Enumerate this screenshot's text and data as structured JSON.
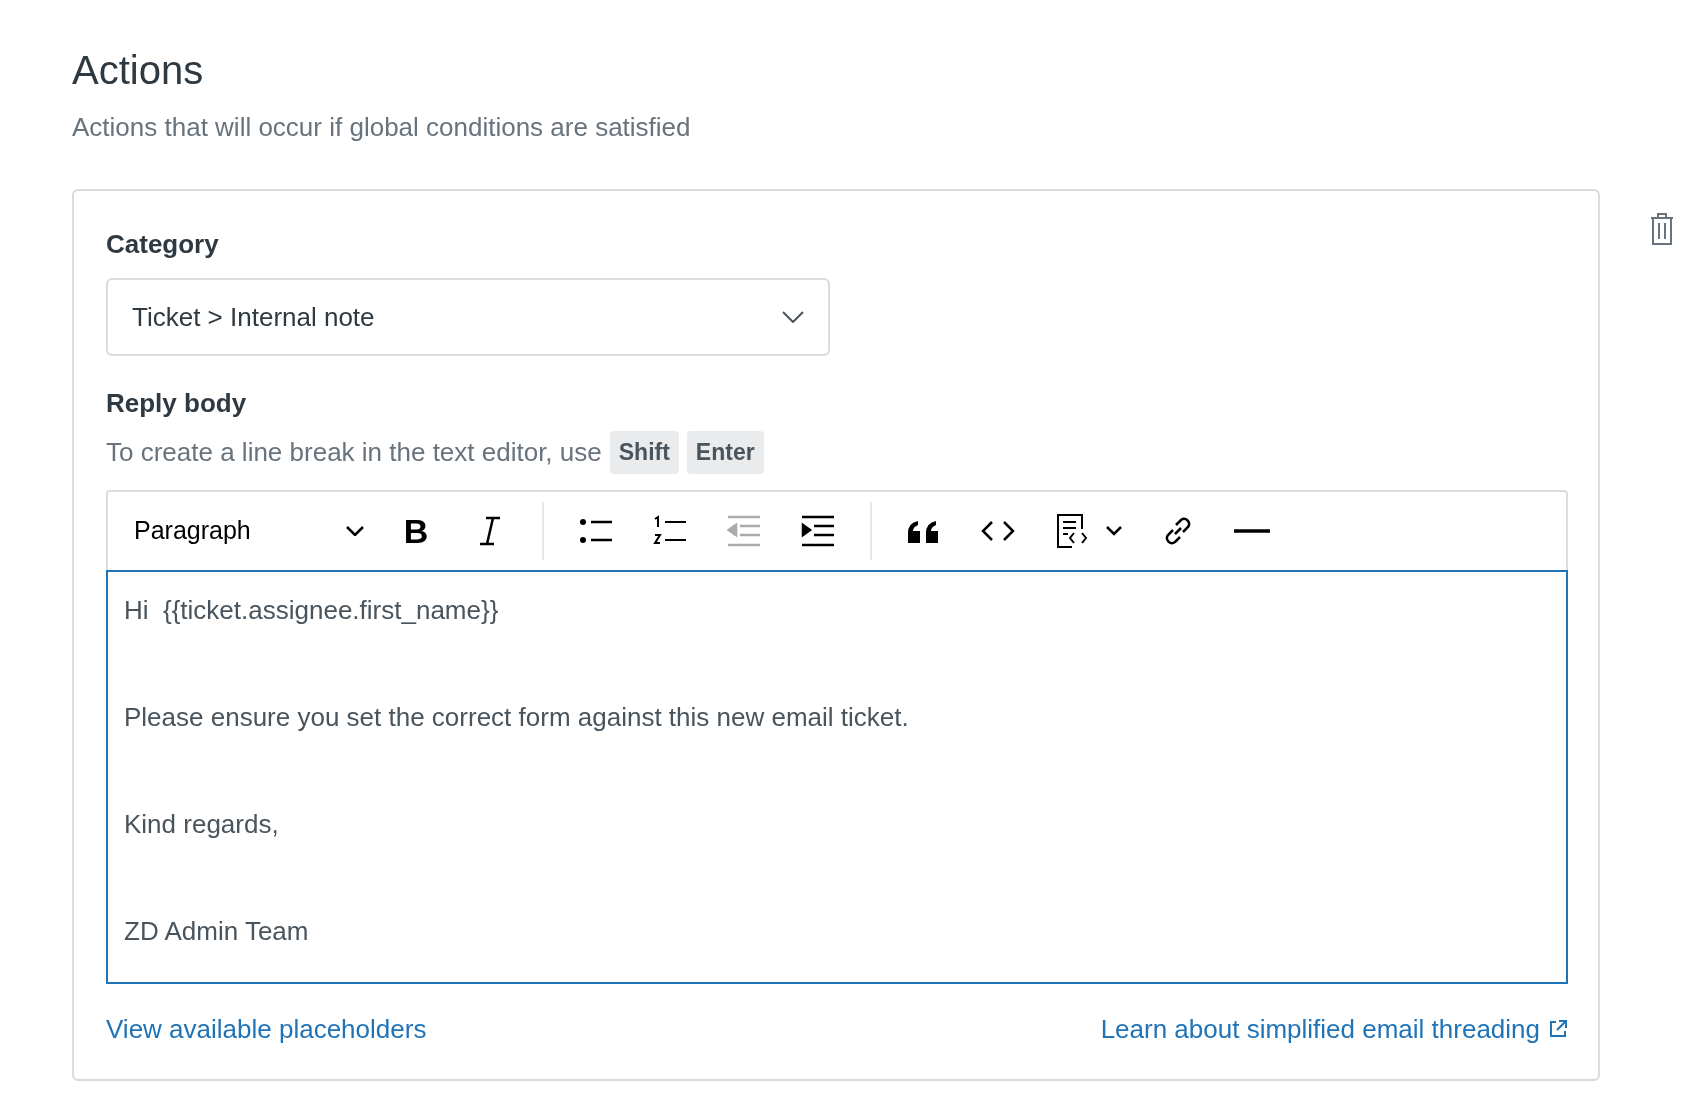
{
  "section": {
    "title": "Actions",
    "subtitle": "Actions that will occur if global conditions are satisfied"
  },
  "category": {
    "label": "Category",
    "value": "Ticket > Internal note"
  },
  "reply_body": {
    "label": "Reply body",
    "hint": "To create a line break in the text editor, use",
    "keys": [
      "Shift",
      "Enter"
    ]
  },
  "editor": {
    "block_format": "Paragraph",
    "focused": true,
    "tools": [
      {
        "kind": "bold",
        "glyph": "B",
        "disabled": false
      },
      {
        "kind": "italic",
        "disabled": false
      },
      {
        "kind": "separator"
      },
      {
        "kind": "bulleted-list",
        "disabled": false
      },
      {
        "kind": "numbered-list",
        "disabled": false
      },
      {
        "kind": "outdent",
        "disabled": true
      },
      {
        "kind": "indent",
        "disabled": false
      },
      {
        "kind": "separator"
      },
      {
        "kind": "quote",
        "disabled": false
      },
      {
        "kind": "code",
        "disabled": false
      },
      {
        "kind": "code-block",
        "disabled": false
      },
      {
        "kind": "link",
        "disabled": false
      },
      {
        "kind": "horizontal-rule",
        "disabled": false
      }
    ],
    "paragraphs": [
      "Hi  {{ticket.assignee.first_name}}",
      "Please ensure you set the correct form against this new email ticket.",
      "Kind regards,",
      "ZD Admin Team"
    ]
  },
  "links": [
    {
      "label": "View available placeholders",
      "external": false
    },
    {
      "label": "Learn about simplified email threading",
      "external": true
    }
  ]
}
